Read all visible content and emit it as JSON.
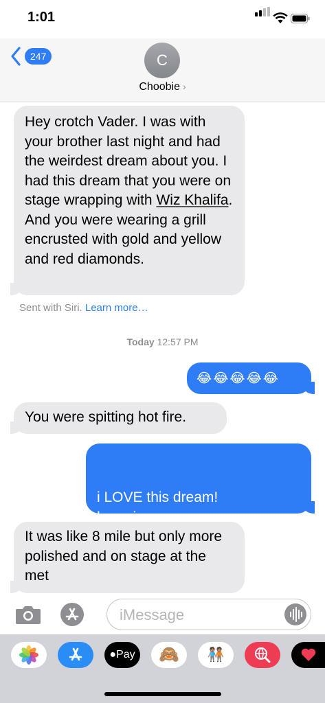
{
  "status_bar": {
    "time": "1:01"
  },
  "header": {
    "back_count": "247",
    "avatar_initial": "C",
    "contact_name": "Choobie",
    "contact_chevron": "›"
  },
  "messages": [
    {
      "sender": "them",
      "text_before": "Hey crotch Vader. I was with your brother last night and had the weirdest dream about you. I had this dream that you were on stage wrapping with ",
      "link": "Wiz Khalifa",
      "text_after": ". And you were wearing a grill encrusted with gold and yellow and red diamonds."
    },
    {
      "sender": "me",
      "text": "😂😂😂😂😂"
    },
    {
      "sender": "them",
      "text": "You were spitting hot fire."
    },
    {
      "sender": "me",
      "text": "i LOVE this dream!\nhope i can see you guys on one of my LA trips"
    },
    {
      "sender": "them",
      "text": "It was like 8 mile but only more polished and on stage at the met"
    }
  ],
  "siri_note": {
    "text": "Sent with Siri.",
    "link": "Learn more…"
  },
  "timestamp": {
    "day": "Today",
    "time": "12:57 PM"
  },
  "compose": {
    "placeholder": "iMessage"
  },
  "app_tray": [
    {
      "name": "Photos",
      "icon": "photos-icon"
    },
    {
      "name": "App Store",
      "icon": "app-store-icon"
    },
    {
      "name": "Apple Pay",
      "icon": "apple-pay-icon",
      "label": "Pay"
    },
    {
      "name": "Animoji",
      "icon": "monkey-emoji-icon",
      "label": "🙈"
    },
    {
      "name": "Memoji",
      "icon": "memoji-icon",
      "label": "🧑🏽‍🤝‍🧑🏽"
    },
    {
      "name": "Web Search",
      "icon": "globe-search-icon"
    },
    {
      "name": "Digital Touch",
      "icon": "heart-touch-icon"
    }
  ],
  "colors": {
    "blue": "#2f7df6",
    "received_bubble": "#e9e9eb",
    "header_bg": "#f6f6f7",
    "tray_bg": "#d1d3d8"
  }
}
